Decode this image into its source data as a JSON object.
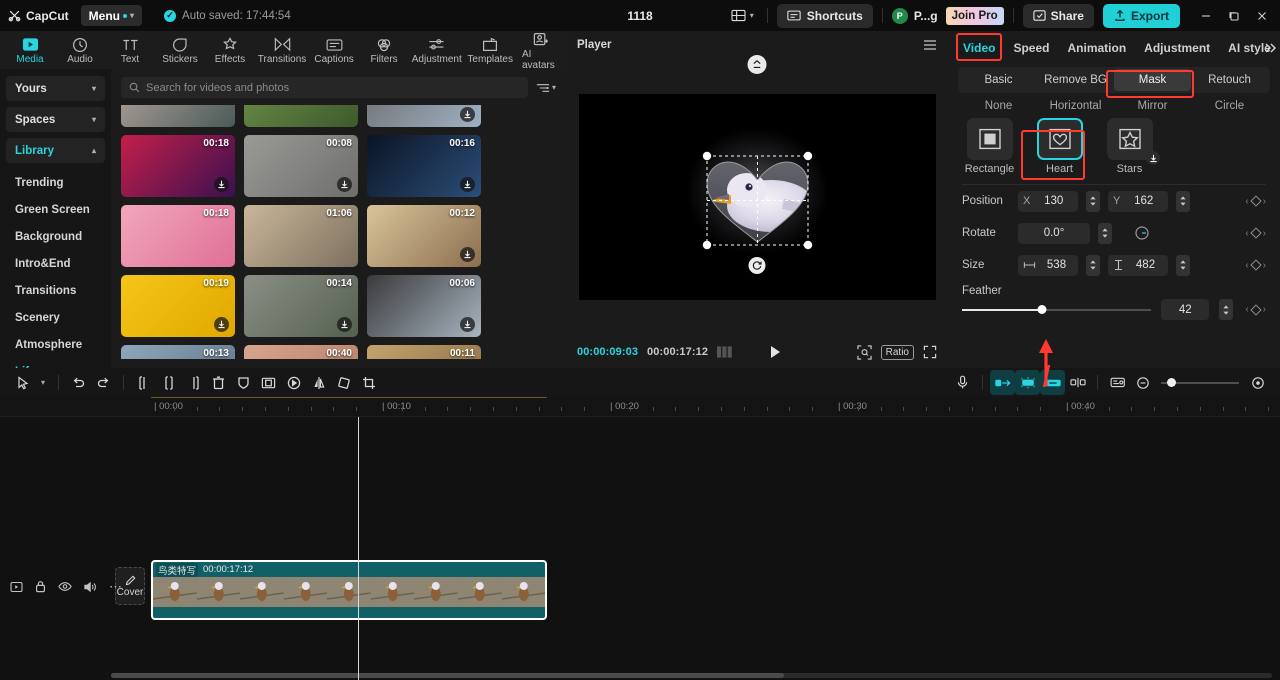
{
  "titlebar": {
    "brand": "CapCut",
    "menu_label": "Menu",
    "autosave": "Auto saved: 17:44:54",
    "project_name": "1118",
    "shortcuts_label": "Shortcuts",
    "profile_initial": "P",
    "profile_name": "P...g",
    "join_pro_label": "Join Pro",
    "share_label": "Share",
    "export_label": "Export",
    "icons": {
      "layout": "layout-icon",
      "minimize": "minimize-icon",
      "maximize": "maximize-icon",
      "close": "close-icon"
    }
  },
  "modebar": {
    "items": [
      {
        "label": "Media",
        "icon": "media-icon",
        "active": true
      },
      {
        "label": "Audio",
        "icon": "audio-icon",
        "active": false
      },
      {
        "label": "Text",
        "icon": "text-icon",
        "active": false
      },
      {
        "label": "Stickers",
        "icon": "stickers-icon",
        "active": false
      },
      {
        "label": "Effects",
        "icon": "effects-icon",
        "active": false
      },
      {
        "label": "Transitions",
        "icon": "transitions-icon",
        "active": false
      },
      {
        "label": "Captions",
        "icon": "captions-icon",
        "active": false
      },
      {
        "label": "Filters",
        "icon": "filters-icon",
        "active": false
      },
      {
        "label": "Adjustment",
        "icon": "adjustment-icon",
        "active": false
      },
      {
        "label": "Templates",
        "icon": "templates-icon",
        "active": false
      },
      {
        "label": "AI avatars",
        "icon": "ai-avatars-icon",
        "active": false
      }
    ]
  },
  "sidebar": {
    "groups": [
      {
        "label": "Yours",
        "state": "collapsed",
        "active": false
      },
      {
        "label": "Spaces",
        "state": "collapsed",
        "active": false
      },
      {
        "label": "Library",
        "state": "expanded",
        "active": true
      }
    ],
    "items": [
      {
        "label": "Trending",
        "active": false
      },
      {
        "label": "Green Screen",
        "active": false
      },
      {
        "label": "Background",
        "active": false
      },
      {
        "label": "Intro&End",
        "active": false
      },
      {
        "label": "Transitions",
        "active": false
      },
      {
        "label": "Scenery",
        "active": false
      },
      {
        "label": "Atmosphere",
        "active": false
      },
      {
        "label": "Life",
        "active": true
      }
    ]
  },
  "search": {
    "placeholder": "Search for videos and photos",
    "value": "",
    "icon": "search-icon",
    "filter_icon": "filter-icon"
  },
  "thumbnails": {
    "row_top": [
      {
        "duration": "",
        "c1": "#b9a8a0",
        "c2": "#4a5a58",
        "has_download": false
      },
      {
        "duration": "",
        "c1": "#6f8f4a",
        "c2": "#3e5a2c",
        "has_download": false
      },
      {
        "duration": "",
        "c1": "#6b6b6b",
        "c2": "#9fb0c4",
        "has_download": true
      }
    ],
    "rows": [
      [
        {
          "duration": "00:18",
          "c1": "#c41f4a",
          "c2": "#3a1050",
          "has_download": true
        },
        {
          "duration": "00:08",
          "c1": "#9a9a96",
          "c2": "#6e6e6c",
          "has_download": true
        },
        {
          "duration": "00:16",
          "c1": "#0b1424",
          "c2": "#2b4e78",
          "has_download": true
        }
      ],
      [
        {
          "duration": "00:18",
          "c1": "#f0a8bc",
          "c2": "#e06f96",
          "has_download": false
        },
        {
          "duration": "01:06",
          "c1": "#c9b79a",
          "c2": "#7d6f5e",
          "has_download": false
        },
        {
          "duration": "00:12",
          "c1": "#d8c49a",
          "c2": "#8c6f4e",
          "has_download": true
        }
      ],
      [
        {
          "duration": "00:19",
          "c1": "#f5c518",
          "c2": "#e0a800",
          "has_download": true
        },
        {
          "duration": "00:14",
          "c1": "#8a8f86",
          "c2": "#55604f",
          "has_download": true
        },
        {
          "duration": "00:06",
          "c1": "#3a3a3c",
          "c2": "#a8b4c0",
          "has_download": true
        }
      ]
    ],
    "row_bottom": [
      {
        "duration": "00:13",
        "c1": "#8fa7bc",
        "c2": "#5d7286",
        "has_download": false
      },
      {
        "duration": "00:40",
        "c1": "#d9a58e",
        "c2": "#b07a63",
        "has_download": false
      },
      {
        "duration": "00:11",
        "c1": "#c2a36e",
        "c2": "#8a6d42",
        "has_download": false
      }
    ]
  },
  "player": {
    "title": "Player",
    "menu_icon": "hamburger-icon",
    "collapse_icon": "collapse-icon",
    "current_time": "00:00:09:03",
    "total_time": "00:00:17:12",
    "frame_icon": "frames-icon",
    "play_icon": "play-icon",
    "zoom_fit_icon": "zoom-fit-icon",
    "ratio_label": "Ratio",
    "fullscreen_icon": "fullscreen-icon",
    "rotate_handle_icon": "rotate-icon"
  },
  "inspector": {
    "tabs": [
      {
        "label": "Video",
        "active": true
      },
      {
        "label": "Speed",
        "active": false
      },
      {
        "label": "Animation",
        "active": false
      },
      {
        "label": "Adjustment",
        "active": false
      },
      {
        "label": "AI style",
        "active": false
      }
    ],
    "more_icon": "chevron-right-icon",
    "segments": [
      {
        "label": "Basic",
        "active": false
      },
      {
        "label": "Remove BG",
        "active": false
      },
      {
        "label": "Mask",
        "active": true
      },
      {
        "label": "Retouch",
        "active": false
      }
    ],
    "mask_types": [
      "None",
      "Horizontal",
      "Mirror",
      "Circle"
    ],
    "shapes": [
      {
        "label": "Rectangle",
        "icon": "rectangle-mask-icon",
        "selected": false,
        "download": false
      },
      {
        "label": "Heart",
        "icon": "heart-mask-icon",
        "selected": true,
        "download": false
      },
      {
        "label": "Stars",
        "icon": "star-mask-icon",
        "selected": false,
        "download": true
      }
    ],
    "position": {
      "label": "Position",
      "x_label": "X",
      "x_value": "130",
      "y_label": "Y",
      "y_value": "162"
    },
    "rotate": {
      "label": "Rotate",
      "value": "0.0°",
      "dial_icon": "rotate-dial-icon"
    },
    "size": {
      "label": "Size",
      "w_icon": "width-icon",
      "w_value": "538",
      "h_icon": "height-icon",
      "h_value": "482"
    },
    "feather": {
      "label": "Feather",
      "value": "42",
      "percent": 42
    },
    "keyframe_icon": "keyframe-diamond-icon"
  },
  "timeline": {
    "tools_left": [
      "select-cursor-icon",
      "cursor-dropdown-icon",
      "undo-icon",
      "redo-icon",
      "split-icon",
      "trim-left-icon",
      "trim-right-icon",
      "delete-icon",
      "mask-tool-icon",
      "crop-frame-icon",
      "freeze-icon",
      "mirror-icon",
      "rotate-tool-icon",
      "crop-icon"
    ],
    "tools_right": [
      "microphone-icon",
      "clip-edit-icon",
      "auto-cut-icon",
      "clip-link-icon",
      "split-track-icon",
      "proxy-icon",
      "zoom-out-icon",
      "zoom-slider",
      "zoom-in-icon"
    ],
    "ruler_labels": [
      "00:00",
      "00:10",
      "00:20",
      "00:30",
      "00:40"
    ],
    "track_icons": [
      "video-track-icon",
      "lock-icon",
      "eye-icon",
      "speaker-icon",
      "more-icon"
    ],
    "cover_label": "Cover",
    "cover_icon": "pencil-icon",
    "clip": {
      "tag": "鸟类特写",
      "duration": "00:00:17:12"
    },
    "playhead_time": "00:09"
  },
  "annotations": {
    "color": "#ff3b30",
    "boxes": [
      "video-tab",
      "mask-segment",
      "heart-shape"
    ],
    "arrow": "feather-slider-arrow"
  }
}
